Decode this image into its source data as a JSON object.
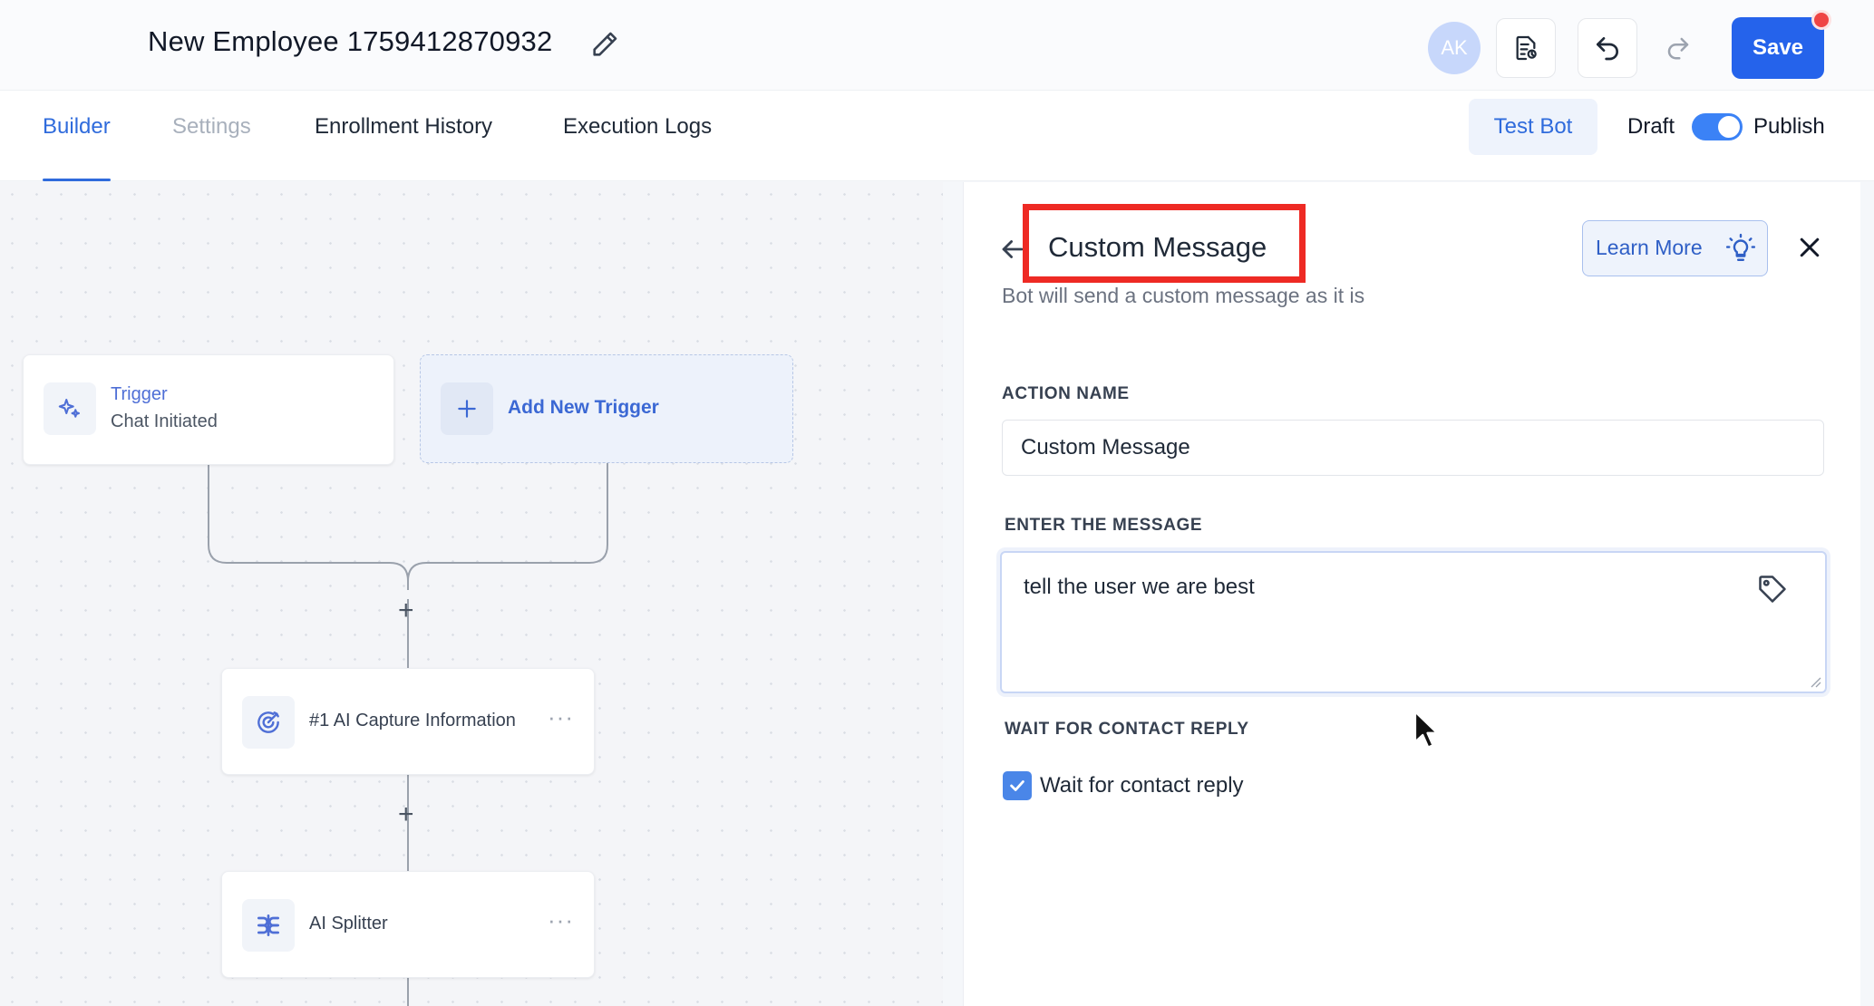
{
  "header": {
    "title": "New Employee 1759412870932",
    "avatar_initials": "AK",
    "save_label": "Save"
  },
  "tabs": [
    {
      "label": "Builder",
      "state": "active"
    },
    {
      "label": "Settings",
      "state": "disabled"
    },
    {
      "label": "Enrollment History",
      "state": "normal"
    },
    {
      "label": "Execution Logs",
      "state": "normal"
    }
  ],
  "toolbar": {
    "test_bot_label": "Test Bot",
    "draft_label": "Draft",
    "publish_label": "Publish",
    "publish_toggle_on": true
  },
  "canvas": {
    "trigger": {
      "title": "Trigger",
      "subtitle": "Chat Initiated"
    },
    "add_trigger_label": "Add New Trigger",
    "steps": [
      {
        "label": "#1 AI Capture Information",
        "icon": "target-icon"
      },
      {
        "label": "AI Splitter",
        "icon": "splitter-icon"
      }
    ],
    "more_label": "···",
    "plus_label": "+"
  },
  "panel": {
    "title": "Custom Message",
    "subtitle": "Bot will send a custom message as it is",
    "learn_more_label": "Learn More",
    "action_name_label": "ACTION NAME",
    "action_name_value": "Custom Message",
    "message_label": "ENTER THE MESSAGE",
    "message_value": "tell the user we are best",
    "wait_label": "WAIT FOR CONTACT REPLY",
    "wait_checkbox_label": "Wait for contact reply",
    "wait_checked": true
  },
  "colors": {
    "primary": "#2563eb",
    "accent": "#2f6bdc",
    "highlight": "#ee2a24",
    "notification": "#ef4444"
  }
}
